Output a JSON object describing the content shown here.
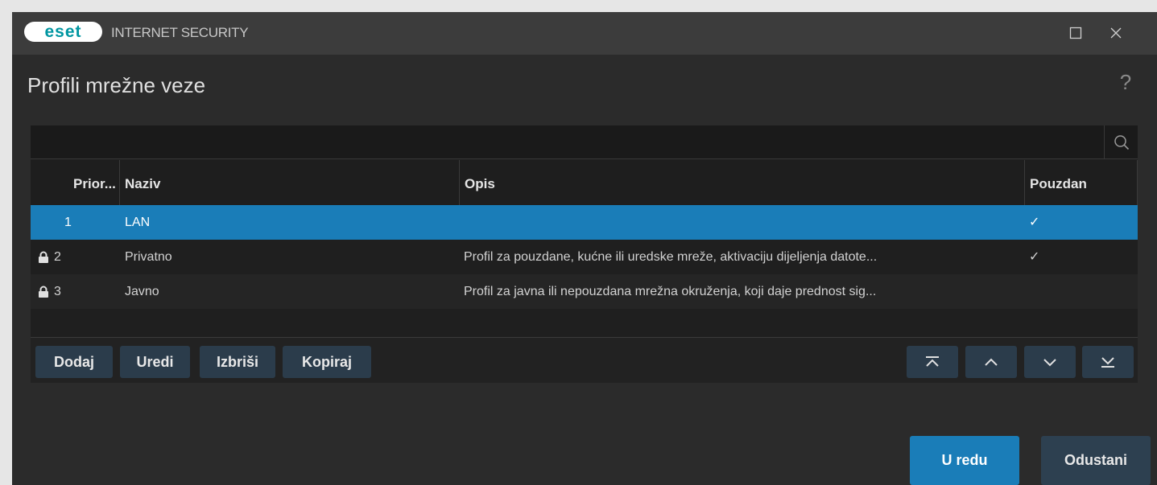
{
  "app": {
    "brand": "eset",
    "product_title": "INTERNET SECURITY"
  },
  "window_controls": {
    "maximize": "maximize-icon",
    "close": "close-icon"
  },
  "page": {
    "title": "Profili mrežne veze",
    "help": "?"
  },
  "search": {
    "value": "",
    "placeholder": ""
  },
  "table": {
    "columns": [
      "Prior...",
      "Naziv",
      "Opis",
      "Pouzdan"
    ],
    "rows": [
      {
        "priority": "1",
        "name": "LAN",
        "description": "",
        "trusted": "✓",
        "locked": false,
        "selected": true
      },
      {
        "priority": "2",
        "name": "Privatno",
        "description": "Profil za pouzdane, kućne ili uredske mreže, aktivaciju dijeljenja datote...",
        "trusted": "✓",
        "locked": true,
        "selected": false
      },
      {
        "priority": "3",
        "name": "Javno",
        "description": "Profil za javna ili nepouzdana mrežna okruženja, koji daje prednost sig...",
        "trusted": "",
        "locked": true,
        "selected": false
      }
    ]
  },
  "actions": {
    "add": "Dodaj",
    "edit": "Uredi",
    "delete": "Izbriši",
    "copy": "Kopiraj"
  },
  "navigation": {
    "top": "move-to-top-icon",
    "up": "move-up-icon",
    "down": "move-down-icon",
    "bottom": "move-to-bottom-icon"
  },
  "dialog": {
    "ok": "U redu",
    "cancel": "Odustani"
  },
  "colors": {
    "accent": "#1a7db8",
    "window_bg": "#2b2b2b",
    "titlebar_bg": "#3c3c3c",
    "button_bg": "#2b3c4b",
    "brand": "#0096a1"
  }
}
